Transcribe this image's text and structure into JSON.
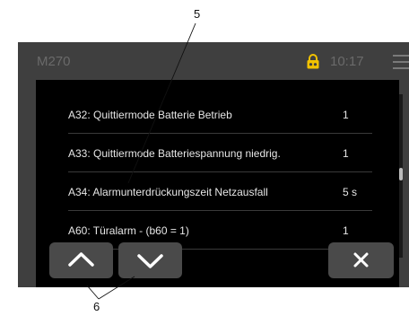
{
  "header": {
    "device_name": "M270",
    "time": "10:17",
    "lock_icon": "lock-icon",
    "menu_icon": "hamburger-menu-icon"
  },
  "parameters": [
    {
      "name": "A32:  Quittiermode Batterie Betrieb",
      "value": "1"
    },
    {
      "name": "A33:  Quittiermode Batteriespannung niedrig.",
      "value": "1"
    },
    {
      "name": "A34:  Alarmunterdrückungszeit Netzausfall",
      "value": "5 s"
    },
    {
      "name": "A60:  Türalarm - (b60 = 1)",
      "value": "1"
    }
  ],
  "buttons": {
    "up_icon": "chevron-up-icon",
    "down_icon": "chevron-down-icon",
    "close_icon": "close-icon"
  },
  "callouts": {
    "label_5": "5",
    "label_6": "6"
  },
  "colors": {
    "frame": "#3f3f3f",
    "panel": "#000000",
    "button": "#4a4a4a",
    "lock_accent": "#f2c200"
  }
}
